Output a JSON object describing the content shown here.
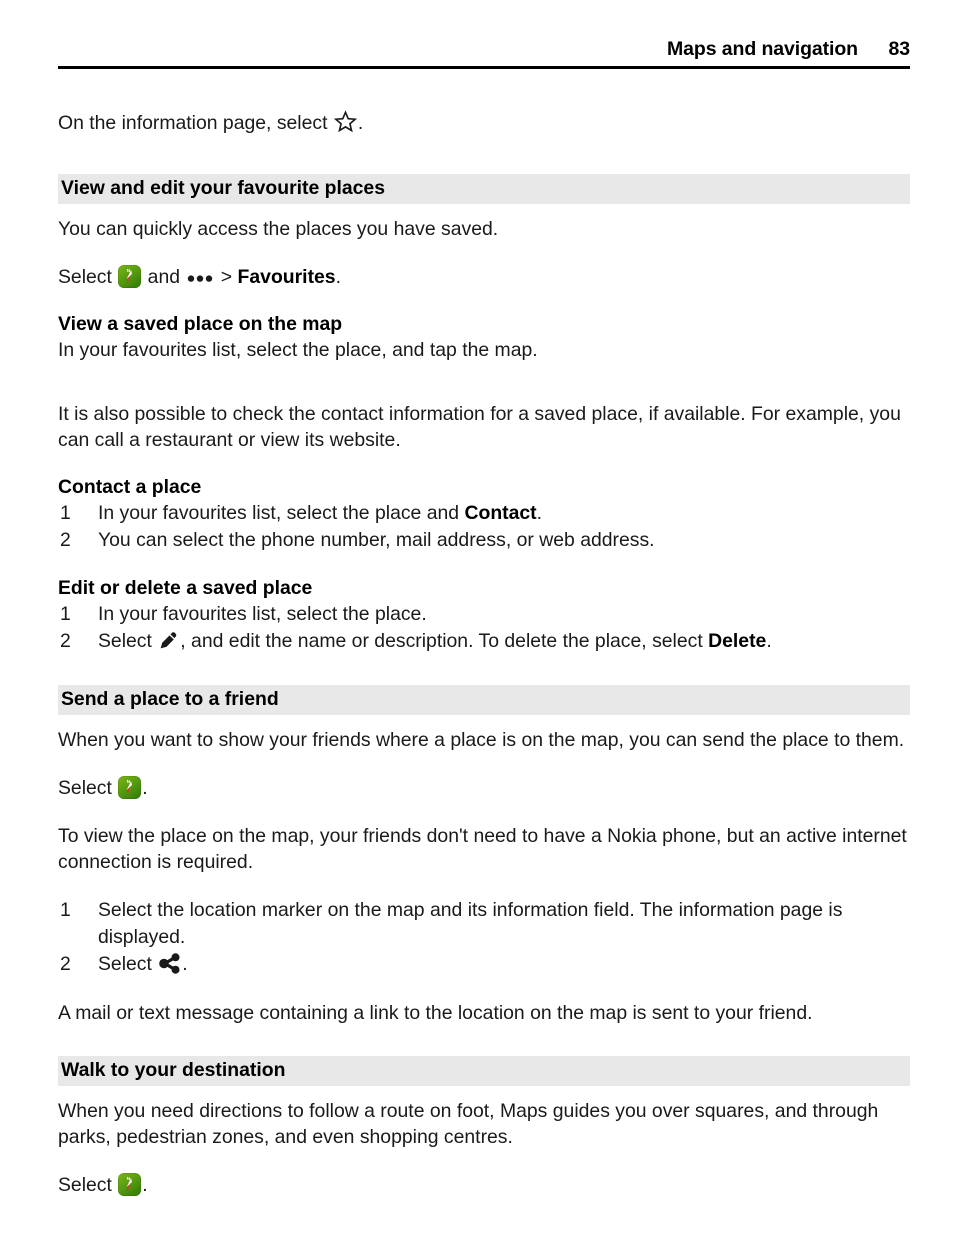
{
  "header": {
    "title": "Maps and navigation",
    "page_number": "83"
  },
  "intro": {
    "before": "On the information page, select ",
    "after": "."
  },
  "sections": [
    {
      "band_title": "View and edit your favourite places",
      "intro_paragraph": "You can quickly access the places you have saved.",
      "select_line": {
        "prefix": "Select ",
        "middle": " and ",
        "suffix_arrow": " > ",
        "bold_target": "Favourites",
        "end": "."
      },
      "sub_sections": [
        {
          "heading": "View a saved place on the map",
          "body": "In your favourites list, select the place, and tap the map."
        }
      ],
      "note_paragraph": "It is also possible to check the contact information for a saved place, if available. For example, you can call a restaurant or view its website.",
      "contact_block": {
        "heading": "Contact a place",
        "steps": [
          {
            "num": "1",
            "text_before": "In your favourites list, select the place and ",
            "bold": "Contact",
            "text_after": "."
          },
          {
            "num": "2",
            "text_before": "You can select the phone number, mail address, or web address.",
            "bold": "",
            "text_after": ""
          }
        ]
      },
      "edit_block": {
        "heading": "Edit or delete a saved place",
        "steps": [
          {
            "num": "1",
            "text_before": "In your favourites list, select the place.",
            "bold": "",
            "text_after": ""
          },
          {
            "num": "2",
            "text_before": "Select ",
            "text_mid": ", and edit the name or description. To delete the place, select ",
            "bold": "Delete",
            "text_after": "."
          }
        ]
      }
    },
    {
      "band_title": "Send a place to a friend",
      "intro_paragraph": "When you want to show your friends where a place is on the map, you can send the place to them.",
      "select_line": {
        "prefix": "Select ",
        "end": "."
      },
      "note_paragraph": "To view the place on the map, your friends don't need to have a Nokia phone, but an active internet connection is required.",
      "steps": [
        {
          "num": "1",
          "text": "Select the location marker on the map and its information field. The information page is displayed."
        },
        {
          "num": "2",
          "text_before": "Select ",
          "text_after": "."
        }
      ],
      "closing_paragraph": "A mail or text message containing a link to the location on the map is sent to your friend."
    },
    {
      "band_title": "Walk to your destination",
      "intro_paragraph": "When you need directions to follow a route on foot, Maps guides you over squares, and through parks, pedestrian zones, and even shopping centres.",
      "select_line": {
        "prefix": "Select ",
        "end": "."
      }
    }
  ],
  "icons": {
    "maps": "maps-compass-icon",
    "dots": "options-menu-icon",
    "star": "favourite-star-icon",
    "pencil": "edit-pencil-icon",
    "share": "share-icon"
  },
  "colors": {
    "band_background": "#e8e8e8",
    "text": "#1a1a1a",
    "rule": "#000000",
    "maps_icon_green_light": "#7cb518",
    "maps_icon_green_dark": "#2f7a06",
    "compass_needle_red": "#d62828"
  }
}
